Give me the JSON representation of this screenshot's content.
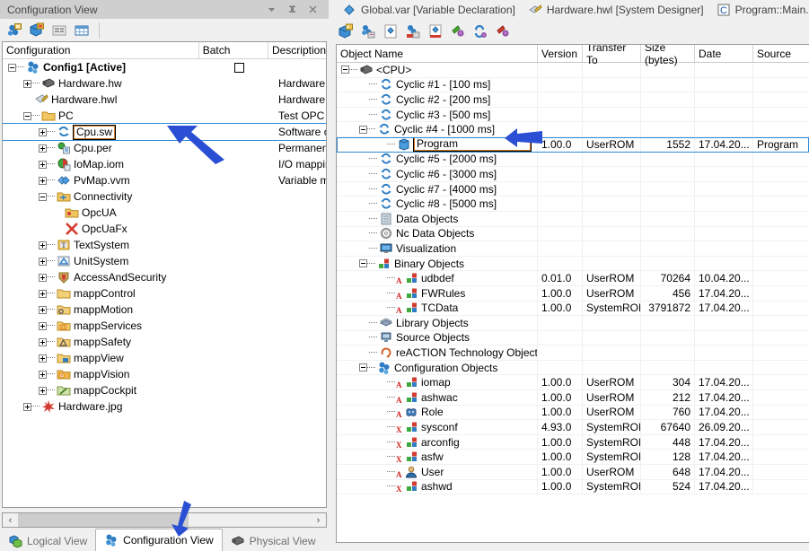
{
  "left_panel": {
    "title": "Configuration View",
    "caption_buttons": [
      {
        "name": "dropdown-icon",
        "glyph": "▼"
      },
      {
        "name": "pin-icon",
        "glyph": "⊥"
      },
      {
        "name": "close-icon",
        "glyph": "✕"
      }
    ],
    "toolbar": [
      {
        "name": "add-configuration-button",
        "icon": "config-add-icon"
      },
      {
        "name": "add-object-button",
        "icon": "cube-add-icon"
      },
      {
        "name": "properties-button",
        "icon": "properties-icon"
      },
      {
        "name": "table-view-button",
        "icon": "table-icon"
      }
    ],
    "columns": [
      "Configuration",
      "Batch",
      "Description"
    ],
    "tree": [
      {
        "level": 0,
        "twist": "minus",
        "icon": "config-icon",
        "label": "Config1 [Active]",
        "bold": true,
        "batch": "checkbox",
        "desc": ""
      },
      {
        "level": 1,
        "twist": "plus",
        "icon": "hardware-hw-icon",
        "label": "Hardware.hw",
        "desc": "Hardware c"
      },
      {
        "level": 1,
        "twist": "none",
        "icon": "hardware-hwl-icon",
        "label": "Hardware.hwl",
        "desc": "Hardware to"
      },
      {
        "level": 1,
        "twist": "minus",
        "icon": "folder-icon",
        "label": "PC",
        "desc": "Test OPC U"
      },
      {
        "level": 2,
        "twist": "plus",
        "icon": "cpu-sw-icon",
        "label": "Cpu.sw",
        "desc": "Software co",
        "selected": true
      },
      {
        "level": 2,
        "twist": "plus",
        "icon": "cpu-per-icon",
        "label": "Cpu.per",
        "desc": "Permanent "
      },
      {
        "level": 2,
        "twist": "plus",
        "icon": "iomap-icon",
        "label": "IoMap.iom",
        "desc": "I/O mapping"
      },
      {
        "level": 2,
        "twist": "plus",
        "icon": "pvmap-icon",
        "label": "PvMap.vvm",
        "desc": "Variable ma"
      },
      {
        "level": 2,
        "twist": "minus",
        "icon": "connectivity-icon",
        "label": "Connectivity",
        "desc": ""
      },
      {
        "level": 3,
        "twist": "none",
        "icon": "opcua-icon",
        "label": "OpcUA",
        "desc": ""
      },
      {
        "level": 3,
        "twist": "none",
        "icon": "opcuafx-icon",
        "label": "OpcUaFx",
        "desc": ""
      },
      {
        "level": 2,
        "twist": "plus",
        "icon": "textsystem-icon",
        "label": "TextSystem",
        "desc": ""
      },
      {
        "level": 2,
        "twist": "plus",
        "icon": "unitsystem-icon",
        "label": "UnitSystem",
        "desc": ""
      },
      {
        "level": 2,
        "twist": "plus",
        "icon": "accessandsecurity-icon",
        "label": "AccessAndSecurity",
        "desc": ""
      },
      {
        "level": 2,
        "twist": "plus",
        "icon": "mappcontrol-icon",
        "label": "mappControl",
        "desc": ""
      },
      {
        "level": 2,
        "twist": "plus",
        "icon": "mappmotion-icon",
        "label": "mappMotion",
        "desc": ""
      },
      {
        "level": 2,
        "twist": "plus",
        "icon": "mappservices-icon",
        "label": "mappServices",
        "desc": ""
      },
      {
        "level": 2,
        "twist": "plus",
        "icon": "mappsafety-icon",
        "label": "mappSafety",
        "desc": ""
      },
      {
        "level": 2,
        "twist": "plus",
        "icon": "mappview-icon",
        "label": "mappView",
        "desc": ""
      },
      {
        "level": 2,
        "twist": "plus",
        "icon": "mappvision-icon",
        "label": "mappVision",
        "desc": ""
      },
      {
        "level": 2,
        "twist": "plus",
        "icon": "mappcockpit-icon",
        "label": "mappCockpit",
        "desc": ""
      },
      {
        "level": 1,
        "twist": "plus",
        "icon": "hardware-jpg-icon",
        "label": "Hardware.jpg",
        "desc": ""
      }
    ],
    "hscroll": {
      "left_arrow": "‹",
      "right_arrow": "›"
    },
    "view_tabs": [
      {
        "label": "Logical View",
        "icon": "logical-view-icon",
        "active": false
      },
      {
        "label": "Configuration View",
        "icon": "configuration-view-icon",
        "active": true
      },
      {
        "label": "Physical View",
        "icon": "physical-view-icon",
        "active": false
      }
    ]
  },
  "right_panel": {
    "document_tabs": [
      {
        "label": "Global.var [Variable Declaration]",
        "icon": "var-icon"
      },
      {
        "label": "Hardware.hwl [System Designer]",
        "icon": "hwl-icon"
      },
      {
        "label": "Program::Main.c [Ansi",
        "icon": "c-file-icon"
      }
    ],
    "toolbar": [
      {
        "name": "new-object-button",
        "icon": "cube-new-icon"
      },
      {
        "name": "build-button",
        "icon": "build-icon"
      },
      {
        "name": "open-button",
        "icon": "diamond-icon"
      },
      {
        "name": "transfer-button",
        "icon": "transfer-icon"
      },
      {
        "name": "delete-button",
        "icon": "diamond-red-icon"
      },
      {
        "name": "plug-green-button",
        "icon": "plug-green-icon"
      },
      {
        "name": "refresh-button",
        "icon": "refresh-icon"
      },
      {
        "name": "plug-red-button",
        "icon": "plug-red-icon"
      }
    ],
    "columns": [
      "Object Name",
      "Version",
      "Transfer To",
      "Size (bytes)",
      "Date",
      "Source"
    ],
    "rows": [
      {
        "level": 0,
        "twist": "minus",
        "icon": "cpu-icon",
        "name": "<CPU>",
        "version": "",
        "transfer": "",
        "size": "",
        "date": "",
        "source": ""
      },
      {
        "level": 1,
        "twist": "none",
        "icon": "cyclic-icon",
        "name": "Cyclic #1 - [100 ms]",
        "version": "",
        "transfer": "",
        "size": "",
        "date": "",
        "source": ""
      },
      {
        "level": 1,
        "twist": "none",
        "icon": "cyclic-icon",
        "name": "Cyclic #2 - [200 ms]",
        "version": "",
        "transfer": "",
        "size": "",
        "date": "",
        "source": ""
      },
      {
        "level": 1,
        "twist": "none",
        "icon": "cyclic-icon",
        "name": "Cyclic #3 - [500 ms]",
        "version": "",
        "transfer": "",
        "size": "",
        "date": "",
        "source": ""
      },
      {
        "level": 1,
        "twist": "minus",
        "icon": "cyclic-icon",
        "name": "Cyclic #4 - [1000 ms]",
        "version": "",
        "transfer": "",
        "size": "",
        "date": "",
        "source": ""
      },
      {
        "level": 2,
        "twist": "none",
        "icon": "program-icon",
        "name": "Program",
        "version": "1.00.0",
        "transfer": "UserROM",
        "size": "1552",
        "date": "17.04.20...",
        "source": "Program",
        "selected": true
      },
      {
        "level": 1,
        "twist": "none",
        "icon": "cyclic-icon",
        "name": "Cyclic #5 - [2000 ms]",
        "version": "",
        "transfer": "",
        "size": "",
        "date": "",
        "source": ""
      },
      {
        "level": 1,
        "twist": "none",
        "icon": "cyclic-icon",
        "name": "Cyclic #6 - [3000 ms]",
        "version": "",
        "transfer": "",
        "size": "",
        "date": "",
        "source": ""
      },
      {
        "level": 1,
        "twist": "none",
        "icon": "cyclic-icon",
        "name": "Cyclic #7 - [4000 ms]",
        "version": "",
        "transfer": "",
        "size": "",
        "date": "",
        "source": ""
      },
      {
        "level": 1,
        "twist": "none",
        "icon": "cyclic-icon",
        "name": "Cyclic #8 - [5000 ms]",
        "version": "",
        "transfer": "",
        "size": "",
        "date": "",
        "source": ""
      },
      {
        "level": 1,
        "twist": "none",
        "icon": "data-objects-icon",
        "name": "Data Objects",
        "version": "",
        "transfer": "",
        "size": "",
        "date": "",
        "source": ""
      },
      {
        "level": 1,
        "twist": "none",
        "icon": "nc-data-objects-icon",
        "name": "Nc Data Objects",
        "version": "",
        "transfer": "",
        "size": "",
        "date": "",
        "source": ""
      },
      {
        "level": 1,
        "twist": "none",
        "icon": "visualization-icon",
        "name": "Visualization",
        "version": "",
        "transfer": "",
        "size": "",
        "date": "",
        "source": ""
      },
      {
        "level": 1,
        "twist": "minus",
        "icon": "binary-objects-icon",
        "name": "Binary Objects",
        "version": "",
        "transfer": "",
        "size": "",
        "date": "",
        "source": ""
      },
      {
        "level": 2,
        "twist": "none",
        "icon": "binary-item-icon",
        "badge": "A",
        "name": "udbdef",
        "version": "0.01.0",
        "transfer": "UserROM",
        "size": "70264",
        "date": "10.04.20...",
        "source": ""
      },
      {
        "level": 2,
        "twist": "none",
        "icon": "binary-item-icon",
        "badge": "A",
        "name": "FWRules",
        "version": "1.00.0",
        "transfer": "UserROM",
        "size": "456",
        "date": "17.04.20...",
        "source": ""
      },
      {
        "level": 2,
        "twist": "none",
        "icon": "binary-item-icon",
        "badge": "A",
        "name": "TCData",
        "version": "1.00.0",
        "transfer": "SystemROM",
        "size": "3791872",
        "date": "17.04.20...",
        "source": ""
      },
      {
        "level": 1,
        "twist": "none",
        "icon": "library-objects-icon",
        "name": "Library Objects",
        "version": "",
        "transfer": "",
        "size": "",
        "date": "",
        "source": ""
      },
      {
        "level": 1,
        "twist": "none",
        "icon": "source-objects-icon",
        "name": "Source Objects",
        "version": "",
        "transfer": "",
        "size": "",
        "date": "",
        "source": ""
      },
      {
        "level": 1,
        "twist": "none",
        "icon": "reaction-icon",
        "name": "reACTION Technology Objects",
        "version": "",
        "transfer": "",
        "size": "",
        "date": "",
        "source": ""
      },
      {
        "level": 1,
        "twist": "minus",
        "icon": "configuration-objects-icon",
        "name": "Configuration Objects",
        "version": "",
        "transfer": "",
        "size": "",
        "date": "",
        "source": ""
      },
      {
        "level": 2,
        "twist": "none",
        "icon": "config-item-icon",
        "badge": "A",
        "name": "iomap",
        "version": "1.00.0",
        "transfer": "UserROM",
        "size": "304",
        "date": "17.04.20...",
        "source": ""
      },
      {
        "level": 2,
        "twist": "none",
        "icon": "config-item-icon",
        "badge": "A",
        "name": "ashwac",
        "version": "1.00.0",
        "transfer": "UserROM",
        "size": "212",
        "date": "17.04.20...",
        "source": ""
      },
      {
        "level": 2,
        "twist": "none",
        "icon": "role-icon",
        "badge": "A",
        "name": "Role",
        "version": "1.00.0",
        "transfer": "UserROM",
        "size": "760",
        "date": "17.04.20...",
        "source": ""
      },
      {
        "level": 2,
        "twist": "none",
        "icon": "config-item-icon",
        "badge": "X",
        "name": "sysconf",
        "version": "4.93.0",
        "transfer": "SystemROM",
        "size": "67640",
        "date": "26.09.20...",
        "source": ""
      },
      {
        "level": 2,
        "twist": "none",
        "icon": "config-item-icon",
        "badge": "X",
        "name": "arconfig",
        "version": "1.00.0",
        "transfer": "SystemROM",
        "size": "448",
        "date": "17.04.20...",
        "source": ""
      },
      {
        "level": 2,
        "twist": "none",
        "icon": "config-item-icon",
        "badge": "X",
        "name": "asfw",
        "version": "1.00.0",
        "transfer": "SystemROM",
        "size": "128",
        "date": "17.04.20...",
        "source": ""
      },
      {
        "level": 2,
        "twist": "none",
        "icon": "user-icon",
        "badge": "A",
        "name": "User",
        "version": "1.00.0",
        "transfer": "UserROM",
        "size": "648",
        "date": "17.04.20...",
        "source": ""
      },
      {
        "level": 2,
        "twist": "none",
        "icon": "config-item-icon",
        "badge": "X",
        "name": "ashwd",
        "version": "1.00.0",
        "transfer": "SystemROM",
        "size": "524",
        "date": "17.04.20...",
        "source": ""
      }
    ]
  },
  "annotations": {
    "arrow_color": "#2b4fd4",
    "arrows": [
      {
        "name": "arrow-pointing-cpu-sw",
        "target": "Cpu.sw"
      },
      {
        "name": "arrow-pointing-cyclic4",
        "target": "Cyclic #4 - [1000 ms]"
      },
      {
        "name": "arrow-pointing-configuration-view-tab",
        "target": "Configuration View"
      }
    ]
  },
  "colors": {
    "selection_outline": "#2e8ad6",
    "edit_box_border": "#d07d26",
    "titlebar_bg": "#cfcfcf",
    "panel_bg": "#f0f0f0"
  }
}
